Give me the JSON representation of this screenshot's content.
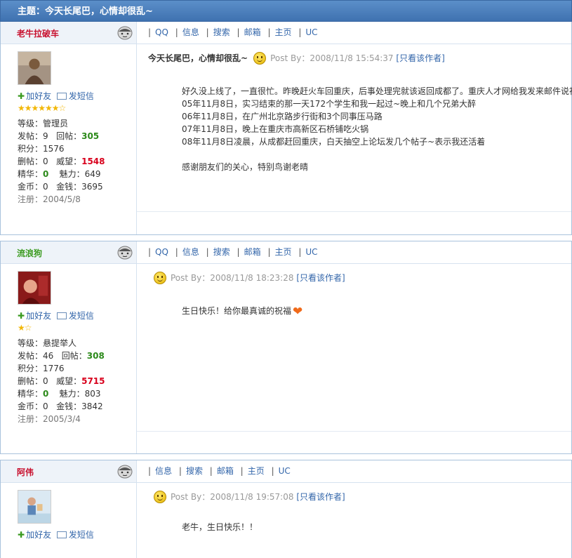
{
  "topic": "主题：今天长尾巴，心情却很乱~",
  "posts": [
    {
      "username": "老牛拉破车",
      "nav": [
        "QQ",
        "信息",
        "搜索",
        "邮箱",
        "主页",
        "UC"
      ],
      "add_friend": "加好友",
      "send_msg": "发短信",
      "stars": "★★★★★★☆",
      "level": "等级：管理员",
      "posts_label": "发帖：9",
      "replies_label": "回帖：",
      "replies": "305",
      "points": "积分：1576",
      "deleted": "删帖：0",
      "prestige_label": "威望：",
      "prestige": "1548",
      "essence_label": "精华：",
      "essence": "0",
      "charm": "魅力：649",
      "coins": "金币：0",
      "money": "金钱：3695",
      "registered": "注册：2004/5/8",
      "post_title": "今天长尾巴，心情却很乱~",
      "post_by": "Post By：2008/11/8 15:54:37",
      "only_author": "[只看该作者]",
      "lines": [
        "好久没上线了，一直很忙。昨晚赶火车回重庆，后事处理完就该返回成都了。重庆人才网给我发来邮件说祝",
        "05年11月8日，实习结束的那一天172个学生和我一起过~晚上和几个兄弟大醉",
        "06年11月8日，在广州北京路步行街和3个同事压马路",
        "07年11月8日，晚上在重庆市高新区石桥铺吃火锅",
        "08年11月8日凌晨，从成都赶回重庆，白天抽空上论坛发几个帖子~表示我还活着",
        "",
        "感谢朋友们的关心，特别鸟谢老晴"
      ]
    },
    {
      "username": "流浪狗",
      "nav": [
        "QQ",
        "信息",
        "搜索",
        "邮箱",
        "主页",
        "UC"
      ],
      "add_friend": "加好友",
      "send_msg": "发短信",
      "stars": "★☆",
      "level": "等级：悬提举人",
      "posts_label": "发帖：46",
      "replies_label": "回帖：",
      "replies": "308",
      "points": "积分：1776",
      "deleted": "删帖：0",
      "prestige_label": "威望：",
      "prestige": "5715",
      "essence_label": "精华：",
      "essence": "0",
      "charm": "魅力：803",
      "coins": "金币：0",
      "money": "金钱：3842",
      "registered": "注册：2005/3/4",
      "post_by": "Post By：2008/11/8 18:23:28",
      "only_author": "[只看该作者]",
      "line": "生日快乐！给你最真诚的祝福"
    },
    {
      "username": "阿伟",
      "nav": [
        "信息",
        "搜索",
        "邮箱",
        "主页",
        "UC"
      ],
      "add_friend": "加好友",
      "send_msg": "发短信",
      "post_by": "Post By：2008/11/8 19:57:08",
      "only_author": "[只看该作者]",
      "line": "老牛，生日快乐！！"
    }
  ]
}
